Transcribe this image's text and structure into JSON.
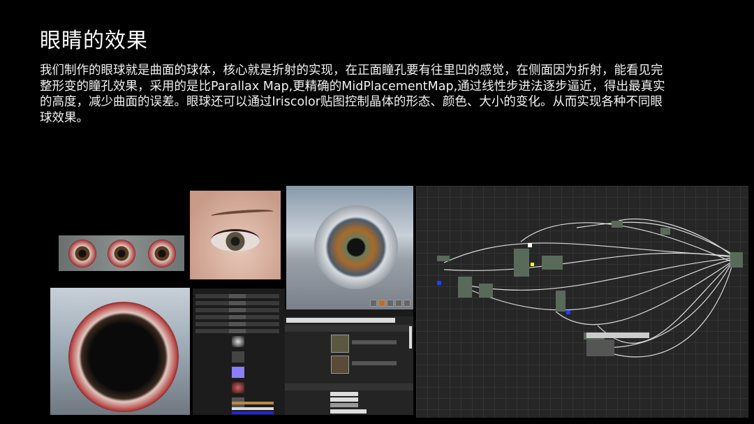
{
  "slide": {
    "title": "眼睛的效果",
    "paragraph": "我们制作的眼球就是曲面的球体，核心就是折射的实现，在正面瞳孔要有往里凹的感觉，在侧面因为折射，能看见完整形变的瞳孔效果，采用的是比Parallax Map,更精确的MidPlacementMap,通过线性步进法逐步逼近，得出最真实的高度，减少曲面的误差。眼球还可以通过Iriscolor贴图控制晶体的形态、颜色、大小的变化。从而实现各种不同眼球效果。"
  },
  "colors": {
    "background": "#000000",
    "text": "#ffffff",
    "graph_bg": "#262626"
  }
}
